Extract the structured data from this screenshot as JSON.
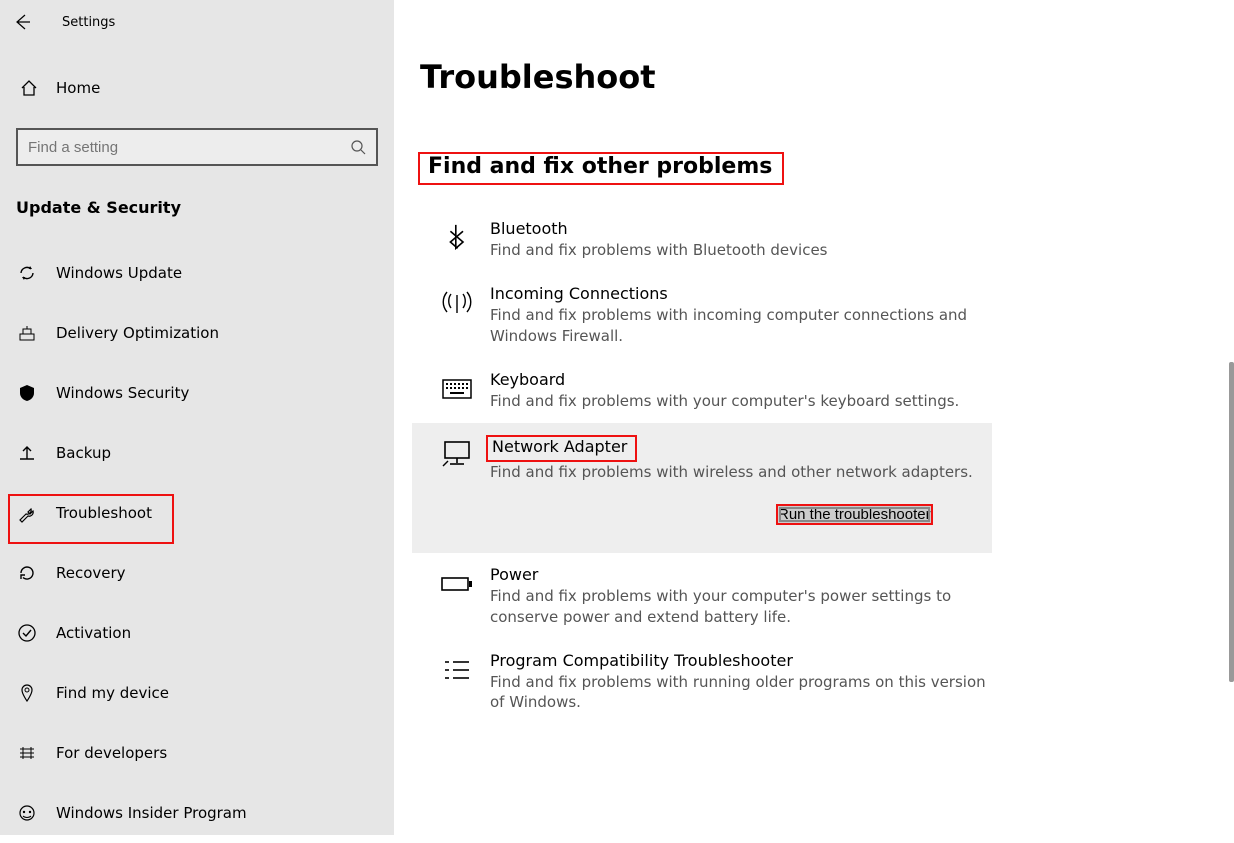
{
  "app_title": "Settings",
  "home_label": "Home",
  "search_placeholder": "Find a setting",
  "category": "Update & Security",
  "nav": [
    {
      "label": "Windows Update"
    },
    {
      "label": "Delivery Optimization"
    },
    {
      "label": "Windows Security"
    },
    {
      "label": "Backup"
    },
    {
      "label": "Troubleshoot"
    },
    {
      "label": "Recovery"
    },
    {
      "label": "Activation"
    },
    {
      "label": "Find my device"
    },
    {
      "label": "For developers"
    },
    {
      "label": "Windows Insider Program"
    }
  ],
  "page_title": "Troubleshoot",
  "section_title": "Find and fix other problems",
  "items": [
    {
      "title": "Bluetooth",
      "desc": "Find and fix problems with Bluetooth devices"
    },
    {
      "title": "Incoming Connections",
      "desc": "Find and fix problems with incoming computer connections and Windows Firewall."
    },
    {
      "title": "Keyboard",
      "desc": "Find and fix problems with your computer's keyboard settings."
    },
    {
      "title": "Network Adapter",
      "desc": "Find and fix problems with wireless and other network adapters."
    },
    {
      "title": "Power",
      "desc": "Find and fix problems with your computer's power settings to conserve power and extend battery life."
    },
    {
      "title": "Program Compatibility Troubleshooter",
      "desc": "Find and fix problems with running older programs on this version of Windows."
    }
  ],
  "run_button": "Run the troubleshooter"
}
